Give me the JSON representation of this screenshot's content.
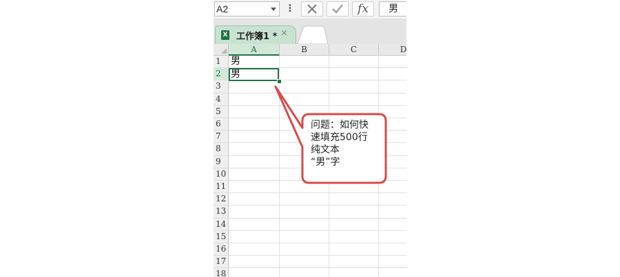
{
  "formula_bar": {
    "name_box": "A2",
    "function_icon": "fx",
    "content": "男"
  },
  "tabs": [
    {
      "label": "工作簿1 *",
      "close": "×",
      "icon": "excel-icon"
    }
  ],
  "grid": {
    "columns": [
      "A",
      "B",
      "C",
      "D"
    ],
    "rows": [
      "1",
      "2",
      "3",
      "4",
      "5",
      "6",
      "7",
      "8",
      "9",
      "10",
      "11",
      "12",
      "13",
      "14",
      "15",
      "16",
      "17",
      "18"
    ],
    "cells": {
      "A1": "男",
      "A2": "男"
    },
    "selected_cell": "A2"
  },
  "callout": {
    "text": "问题：如何快\n速填充500行\n纯文本\n“男”字",
    "border_color": "#d94a4a"
  },
  "colors": {
    "accent": "#217346",
    "selected_header": "#d3e7d9",
    "tab_active": "#c8e2d1"
  }
}
